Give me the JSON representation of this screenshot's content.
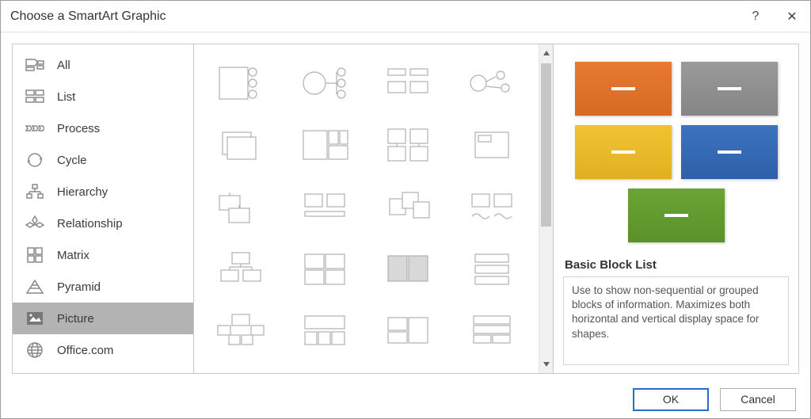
{
  "titlebar": {
    "title": "Choose a SmartArt Graphic",
    "help": "?",
    "close": "✕"
  },
  "categories": [
    {
      "key": "all",
      "label": "All"
    },
    {
      "key": "list",
      "label": "List"
    },
    {
      "key": "process",
      "label": "Process"
    },
    {
      "key": "cycle",
      "label": "Cycle"
    },
    {
      "key": "hierarchy",
      "label": "Hierarchy"
    },
    {
      "key": "relationship",
      "label": "Relationship"
    },
    {
      "key": "matrix",
      "label": "Matrix"
    },
    {
      "key": "pyramid",
      "label": "Pyramid"
    },
    {
      "key": "picture",
      "label": "Picture",
      "selected": true
    },
    {
      "key": "office",
      "label": "Office.com"
    }
  ],
  "preview": {
    "title": "Basic Block List",
    "description": "Use to show non-sequential or grouped blocks of information. Maximizes both horizontal and vertical display space for shapes.",
    "blocks": [
      "orange",
      "gray",
      "yellow",
      "blue",
      "green"
    ]
  },
  "footer": {
    "ok": "OK",
    "cancel": "Cancel"
  }
}
